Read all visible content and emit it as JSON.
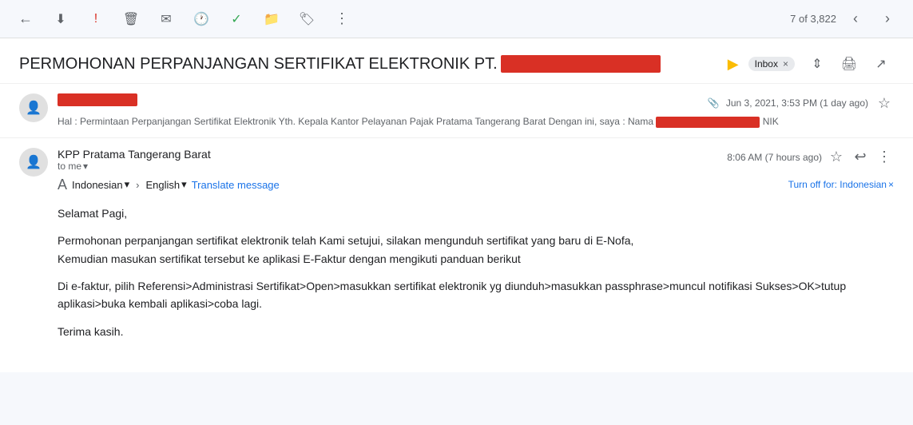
{
  "topbar": {
    "back_icon": "←",
    "save_icon": "⬇",
    "important_icon": "!",
    "delete_icon": "🗑",
    "email_icon": "✉",
    "clock_icon": "🕐",
    "check_icon": "✓",
    "folder_icon": "📁",
    "label_icon": "🏷",
    "more_icon": "⋮",
    "nav_text": "7 of 3,822",
    "prev_icon": "‹",
    "next_icon": "›"
  },
  "subject": {
    "text": "PERMOHONAN PERPANJANGAN SERTIFIKAT ELEKTRONIK PT.",
    "redacted": true,
    "inbox_label": "Inbox",
    "forward_symbol": "▶"
  },
  "first_message": {
    "sender_redacted": true,
    "date": "Jun 3, 2021, 3:53 PM (1 day ago)",
    "snippet": "Hal : Permintaan Perpanjangan Sertifikat Elektronik Yth. Kepala Kantor Pelayanan Pajak Pratama Tangerang Barat Dengan ini, saya : Nama",
    "nik_label": "NIK",
    "clip_icon": "📎"
  },
  "second_message": {
    "sender": "KPP Pratama Tangerang Barat",
    "to_me": "to me",
    "date": "8:06 AM (7 hours ago)",
    "translate_icon": "A",
    "from_lang": "Indonesian",
    "to_lang": "English",
    "translate_label": "Translate message",
    "turn_off_label": "Turn off for: Indonesian",
    "body_lines": [
      "Selamat Pagi,",
      "",
      "Permohonan perpanjangan sertifikat elektronik telah Kami setujui, silakan mengunduh sertifikat yang baru di E-Nofa,\nKemudian masukan sertifikat tersebut ke aplikasi E-Faktur dengan mengikuti panduan berikut",
      "",
      "Di e-faktur, pilih Referensi>Administrasi Sertifikat>Open>masukkan sertifikat elektronik yg diunduh>masukkan passphrase>muncul notifikasi Sukses>OK>tutup aplikasi>buka kembali aplikasi>coba lagi.",
      "",
      "Terima kasih."
    ]
  }
}
